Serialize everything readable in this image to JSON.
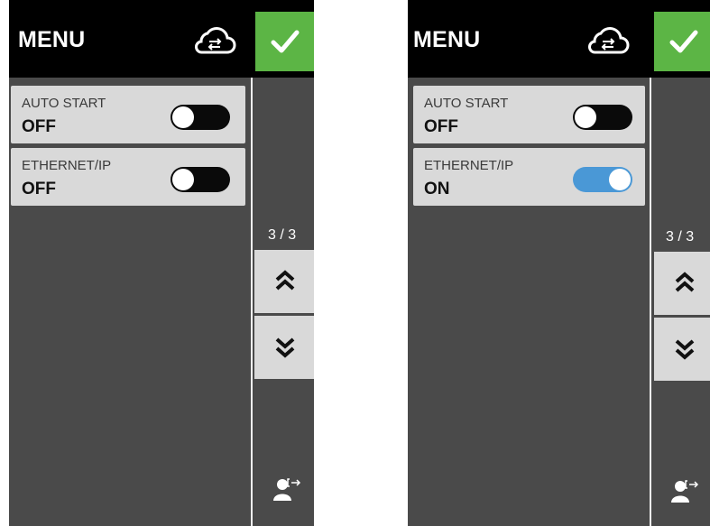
{
  "screens": [
    {
      "title": "MENU",
      "settings": [
        {
          "label": "AUTO START",
          "value": "OFF",
          "enabled": false
        },
        {
          "label": "ETHERNET/IP",
          "value": "OFF",
          "enabled": false
        }
      ],
      "page_indicator": "3 / 3"
    },
    {
      "title": "MENU",
      "settings": [
        {
          "label": "AUTO START",
          "value": "OFF",
          "enabled": false
        },
        {
          "label": "ETHERNET/IP",
          "value": "ON",
          "enabled": true
        }
      ],
      "page_indicator": "3 / 3"
    }
  ],
  "icons": {
    "cloud": "cloud-sync-icon",
    "confirm": "checkmark-icon",
    "up": "double-chevron-up-icon",
    "down": "double-chevron-down-icon",
    "logout": "user-logout-icon"
  },
  "colors": {
    "header": "#000000",
    "panel": "#4a4a4a",
    "card": "#d9d9d9",
    "confirm": "#5cb545",
    "toggle_on": "#4a98d6",
    "toggle_off": "#0a0a0a"
  }
}
